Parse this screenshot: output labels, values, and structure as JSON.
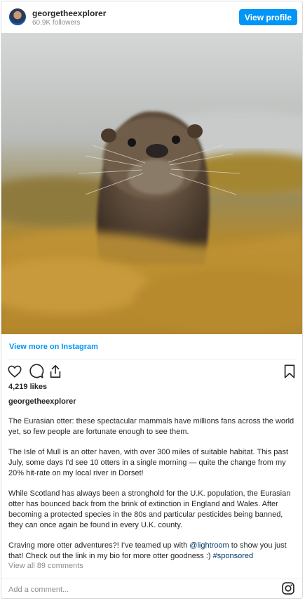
{
  "header": {
    "username": "georgetheexplorer",
    "followers": "60.9K followers",
    "view_profile_label": "View profile"
  },
  "post": {
    "view_more_label": "View more on Instagram",
    "likes": "4,219 likes",
    "caption_user": "georgetheexplorer",
    "caption_paragraphs": [
      "The Eurasian otter: these spectacular mammals have millions fans across the world yet, so few people are fortunate enough to see them.",
      "The Isle of Mull is an otter haven, with over 300 miles of suitable habitat. This past July, some days I'd see 10 otters in a single morning — quite the change from my 20% hit-rate on my local river in Dorset!",
      "While Scotland has always been a stronghold for the U.K. population, the Eurasian otter has bounced back from the brink of extinction in England and Wales. After becoming a protected species in the 80s and particular pesticides being banned, they can once again be found in every U.K. county."
    ],
    "caption_last_pre": "Craving more otter adventures?! I've teamed up with ",
    "caption_mention": "@lightroom",
    "caption_last_mid": " to show you just that! Check out the link in my bio for more otter goodness :) ",
    "caption_hashtag": "#sponsored",
    "comments_link": "View all 89 comments",
    "add_comment_placeholder": "Add a comment..."
  },
  "icons": {
    "avatar": "avatar",
    "like": "heart-icon",
    "comment": "comment-icon",
    "share": "share-icon",
    "save": "bookmark-icon",
    "instagram": "instagram-icon"
  },
  "colors": {
    "accent": "#0095f6",
    "link": "#00376b",
    "muted": "#8e8e8e"
  }
}
